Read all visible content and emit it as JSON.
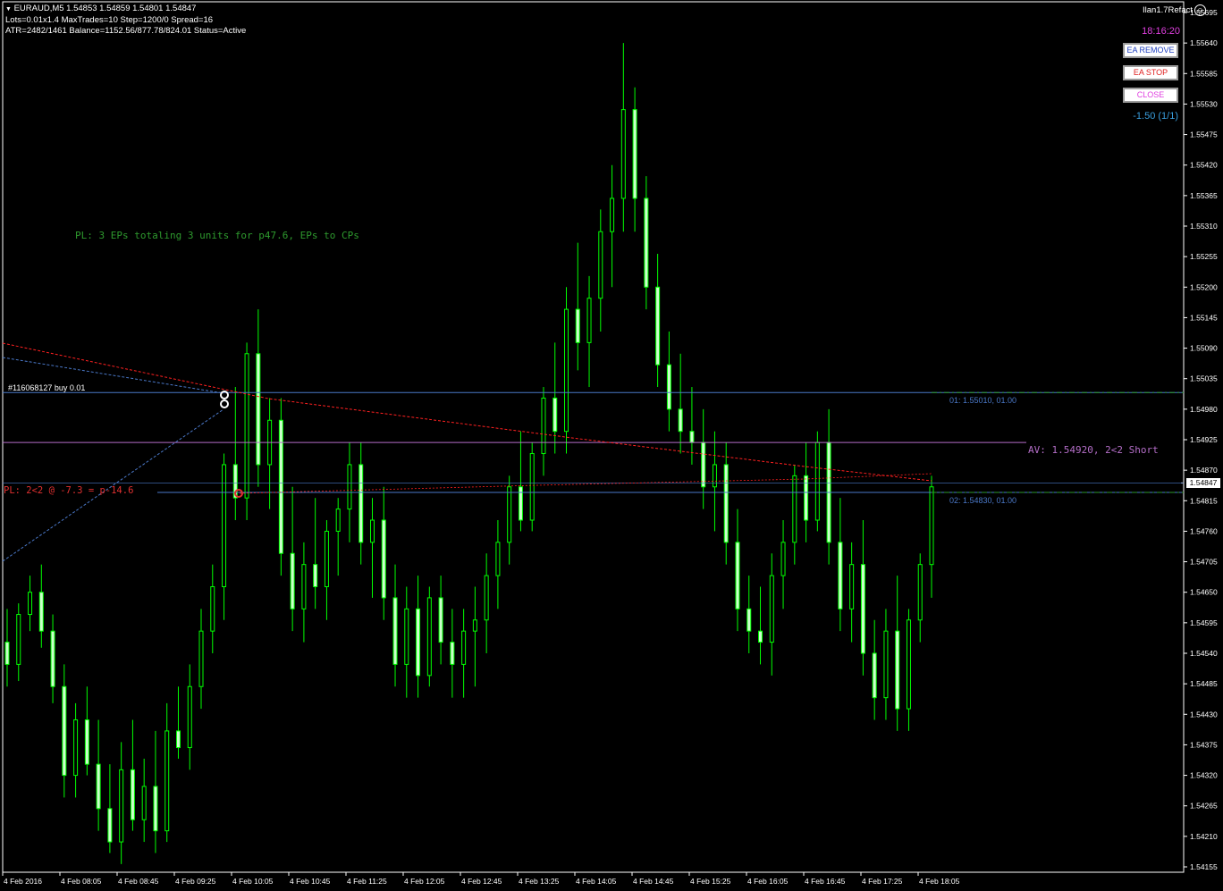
{
  "header": {
    "symbol_line": "EURAUD,M5  1.54853 1.54859 1.54801 1.54847",
    "settings_line": "Lots=0.01x1.4 MaxTrades=10 Step=1200/0 Spread=16",
    "status_line": "ATR=2482/1461 Balance=1152.56/877.78/824.01 Status=Active"
  },
  "ea_panel": {
    "name": "Ilan1.7Refact",
    "time": "18:16:20",
    "remove_label": "EA REMOVE",
    "stop_label": "EA STOP",
    "close_label": "CLOSE",
    "pl_value": "-1.50 (1/1)"
  },
  "annotations": {
    "pl_summary": "PL: 3 EPs totaling 3 units for p47.6, EPs to CPs",
    "order_label": "#116068127 buy 0.01",
    "pl_current": "PL: 2<2 @ -7.3 = p-14.6",
    "av_label": "AV: 1.54920, 2<2 Short",
    "level_01": "01: 1.55010, 01.00",
    "level_02": "02: 1.54830, 01.00"
  },
  "colors": {
    "candle": "#00ff00",
    "candle_body": "#ccffcc",
    "order_line": "#4a78c8",
    "av_line": "#b46ec8",
    "red_trend": "#ff2020",
    "green_dash": "#2e9a2e",
    "annotation_green": "#2e9a2e",
    "annotation_red": "#e03030",
    "ea_time": "#e040e0",
    "ea_pl": "#3aa0e0"
  },
  "chart_data": {
    "type": "candlestick",
    "symbol": "EURAUD",
    "timeframe": "M5",
    "current_price": 1.54847,
    "price_tag": "1.54847",
    "ylim": [
      1.54155,
      1.55695
    ],
    "y_ticks": [
      "1.55695",
      "1.55640",
      "1.55585",
      "1.55530",
      "1.55475",
      "1.55420",
      "1.55365",
      "1.55310",
      "1.55255",
      "1.55200",
      "1.55145",
      "1.55090",
      "1.55035",
      "1.54980",
      "1.54925",
      "1.54870",
      "1.54815",
      "1.54760",
      "1.54705",
      "1.54650",
      "1.54595",
      "1.54540",
      "1.54485",
      "1.54430",
      "1.54375",
      "1.54320",
      "1.54265",
      "1.54210",
      "1.54155"
    ],
    "x_ticks": [
      "4 Feb 2016",
      "4 Feb 08:05",
      "4 Feb 08:45",
      "4 Feb 09:25",
      "4 Feb 10:05",
      "4 Feb 10:45",
      "4 Feb 11:25",
      "4 Feb 12:05",
      "4 Feb 12:45",
      "4 Feb 13:25",
      "4 Feb 14:05",
      "4 Feb 14:45",
      "4 Feb 15:25",
      "4 Feb 16:05",
      "4 Feb 16:45",
      "4 Feb 17:25",
      "4 Feb 18:05"
    ],
    "levels": {
      "order_01": 1.5501,
      "order_02": 1.5483,
      "average": 1.5492
    },
    "ohlc": [
      [
        1.5456,
        1.5462,
        1.5448,
        1.5452
      ],
      [
        1.5452,
        1.5463,
        1.5449,
        1.5461
      ],
      [
        1.5461,
        1.5468,
        1.5458,
        1.5465
      ],
      [
        1.5465,
        1.547,
        1.5455,
        1.5458
      ],
      [
        1.5458,
        1.5461,
        1.5445,
        1.5448
      ],
      [
        1.5448,
        1.5452,
        1.5428,
        1.5432
      ],
      [
        1.5432,
        1.5445,
        1.5428,
        1.5442
      ],
      [
        1.5442,
        1.5448,
        1.5432,
        1.5434
      ],
      [
        1.5434,
        1.5442,
        1.5422,
        1.5426
      ],
      [
        1.5426,
        1.5434,
        1.5418,
        1.542
      ],
      [
        1.542,
        1.5438,
        1.5416,
        1.5433
      ],
      [
        1.5433,
        1.5442,
        1.5422,
        1.5424
      ],
      [
        1.5424,
        1.5435,
        1.542,
        1.543
      ],
      [
        1.543,
        1.544,
        1.5418,
        1.5422
      ],
      [
        1.5422,
        1.5445,
        1.542,
        1.544
      ],
      [
        1.544,
        1.5448,
        1.5435,
        1.5437
      ],
      [
        1.5437,
        1.5452,
        1.5433,
        1.5448
      ],
      [
        1.5448,
        1.5462,
        1.5444,
        1.5458
      ],
      [
        1.5458,
        1.547,
        1.5454,
        1.5466
      ],
      [
        1.5466,
        1.549,
        1.546,
        1.5488
      ],
      [
        1.5488,
        1.5502,
        1.5478,
        1.5482
      ],
      [
        1.5482,
        1.551,
        1.5478,
        1.5508
      ],
      [
        1.5508,
        1.5516,
        1.5484,
        1.5488
      ],
      [
        1.5488,
        1.55,
        1.548,
        1.5496
      ],
      [
        1.5496,
        1.55,
        1.5468,
        1.5472
      ],
      [
        1.5472,
        1.5484,
        1.5458,
        1.5462
      ],
      [
        1.5462,
        1.5474,
        1.5456,
        1.547
      ],
      [
        1.547,
        1.5482,
        1.5462,
        1.5466
      ],
      [
        1.5466,
        1.5478,
        1.546,
        1.5476
      ],
      [
        1.5476,
        1.5482,
        1.5468,
        1.548
      ],
      [
        1.548,
        1.5492,
        1.5474,
        1.5488
      ],
      [
        1.5488,
        1.5492,
        1.547,
        1.5474
      ],
      [
        1.5474,
        1.5482,
        1.5464,
        1.5478
      ],
      [
        1.5478,
        1.5484,
        1.546,
        1.5464
      ],
      [
        1.5464,
        1.547,
        1.5448,
        1.5452
      ],
      [
        1.5452,
        1.5466,
        1.5446,
        1.5462
      ],
      [
        1.5462,
        1.5468,
        1.5446,
        1.545
      ],
      [
        1.545,
        1.5466,
        1.5448,
        1.5464
      ],
      [
        1.5464,
        1.5468,
        1.5452,
        1.5456
      ],
      [
        1.5456,
        1.5462,
        1.5446,
        1.5452
      ],
      [
        1.5452,
        1.5462,
        1.5446,
        1.5458
      ],
      [
        1.5458,
        1.5466,
        1.5448,
        1.546
      ],
      [
        1.546,
        1.5472,
        1.5454,
        1.5468
      ],
      [
        1.5468,
        1.5478,
        1.5462,
        1.5474
      ],
      [
        1.5474,
        1.5486,
        1.547,
        1.5484
      ],
      [
        1.5484,
        1.5494,
        1.5476,
        1.5478
      ],
      [
        1.5478,
        1.5492,
        1.5476,
        1.549
      ],
      [
        1.549,
        1.5502,
        1.5486,
        1.55
      ],
      [
        1.55,
        1.551,
        1.549,
        1.5494
      ],
      [
        1.5494,
        1.552,
        1.549,
        1.5516
      ],
      [
        1.5516,
        1.5528,
        1.5505,
        1.551
      ],
      [
        1.551,
        1.5522,
        1.5502,
        1.5518
      ],
      [
        1.5518,
        1.5534,
        1.5512,
        1.553
      ],
      [
        1.553,
        1.5542,
        1.552,
        1.5536
      ],
      [
        1.5536,
        1.5564,
        1.553,
        1.5552
      ],
      [
        1.5552,
        1.5556,
        1.553,
        1.5536
      ],
      [
        1.5536,
        1.554,
        1.5516,
        1.552
      ],
      [
        1.552,
        1.5526,
        1.5502,
        1.5506
      ],
      [
        1.5506,
        1.5512,
        1.5494,
        1.5498
      ],
      [
        1.5498,
        1.5508,
        1.549,
        1.5494
      ],
      [
        1.5494,
        1.5502,
        1.5488,
        1.5492
      ],
      [
        1.5492,
        1.5498,
        1.548,
        1.5484
      ],
      [
        1.5484,
        1.5494,
        1.5476,
        1.5488
      ],
      [
        1.5488,
        1.5492,
        1.547,
        1.5474
      ],
      [
        1.5474,
        1.548,
        1.5458,
        1.5462
      ],
      [
        1.5462,
        1.5468,
        1.5454,
        1.5458
      ],
      [
        1.5458,
        1.5466,
        1.5452,
        1.5456
      ],
      [
        1.5456,
        1.5472,
        1.545,
        1.5468
      ],
      [
        1.5468,
        1.5478,
        1.5462,
        1.5474
      ],
      [
        1.5474,
        1.5488,
        1.547,
        1.5486
      ],
      [
        1.5486,
        1.5492,
        1.5474,
        1.5478
      ],
      [
        1.5478,
        1.5494,
        1.5476,
        1.5492
      ],
      [
        1.5492,
        1.5498,
        1.547,
        1.5474
      ],
      [
        1.5474,
        1.5482,
        1.5458,
        1.5462
      ],
      [
        1.5462,
        1.5474,
        1.5456,
        1.547
      ],
      [
        1.547,
        1.5478,
        1.545,
        1.5454
      ],
      [
        1.5454,
        1.546,
        1.5442,
        1.5446
      ],
      [
        1.5446,
        1.5462,
        1.5442,
        1.5458
      ],
      [
        1.5458,
        1.5468,
        1.544,
        1.5444
      ],
      [
        1.5444,
        1.5462,
        1.544,
        1.546
      ],
      [
        1.546,
        1.5472,
        1.5456,
        1.547
      ],
      [
        1.547,
        1.5486,
        1.5464,
        1.5484
      ]
    ]
  }
}
